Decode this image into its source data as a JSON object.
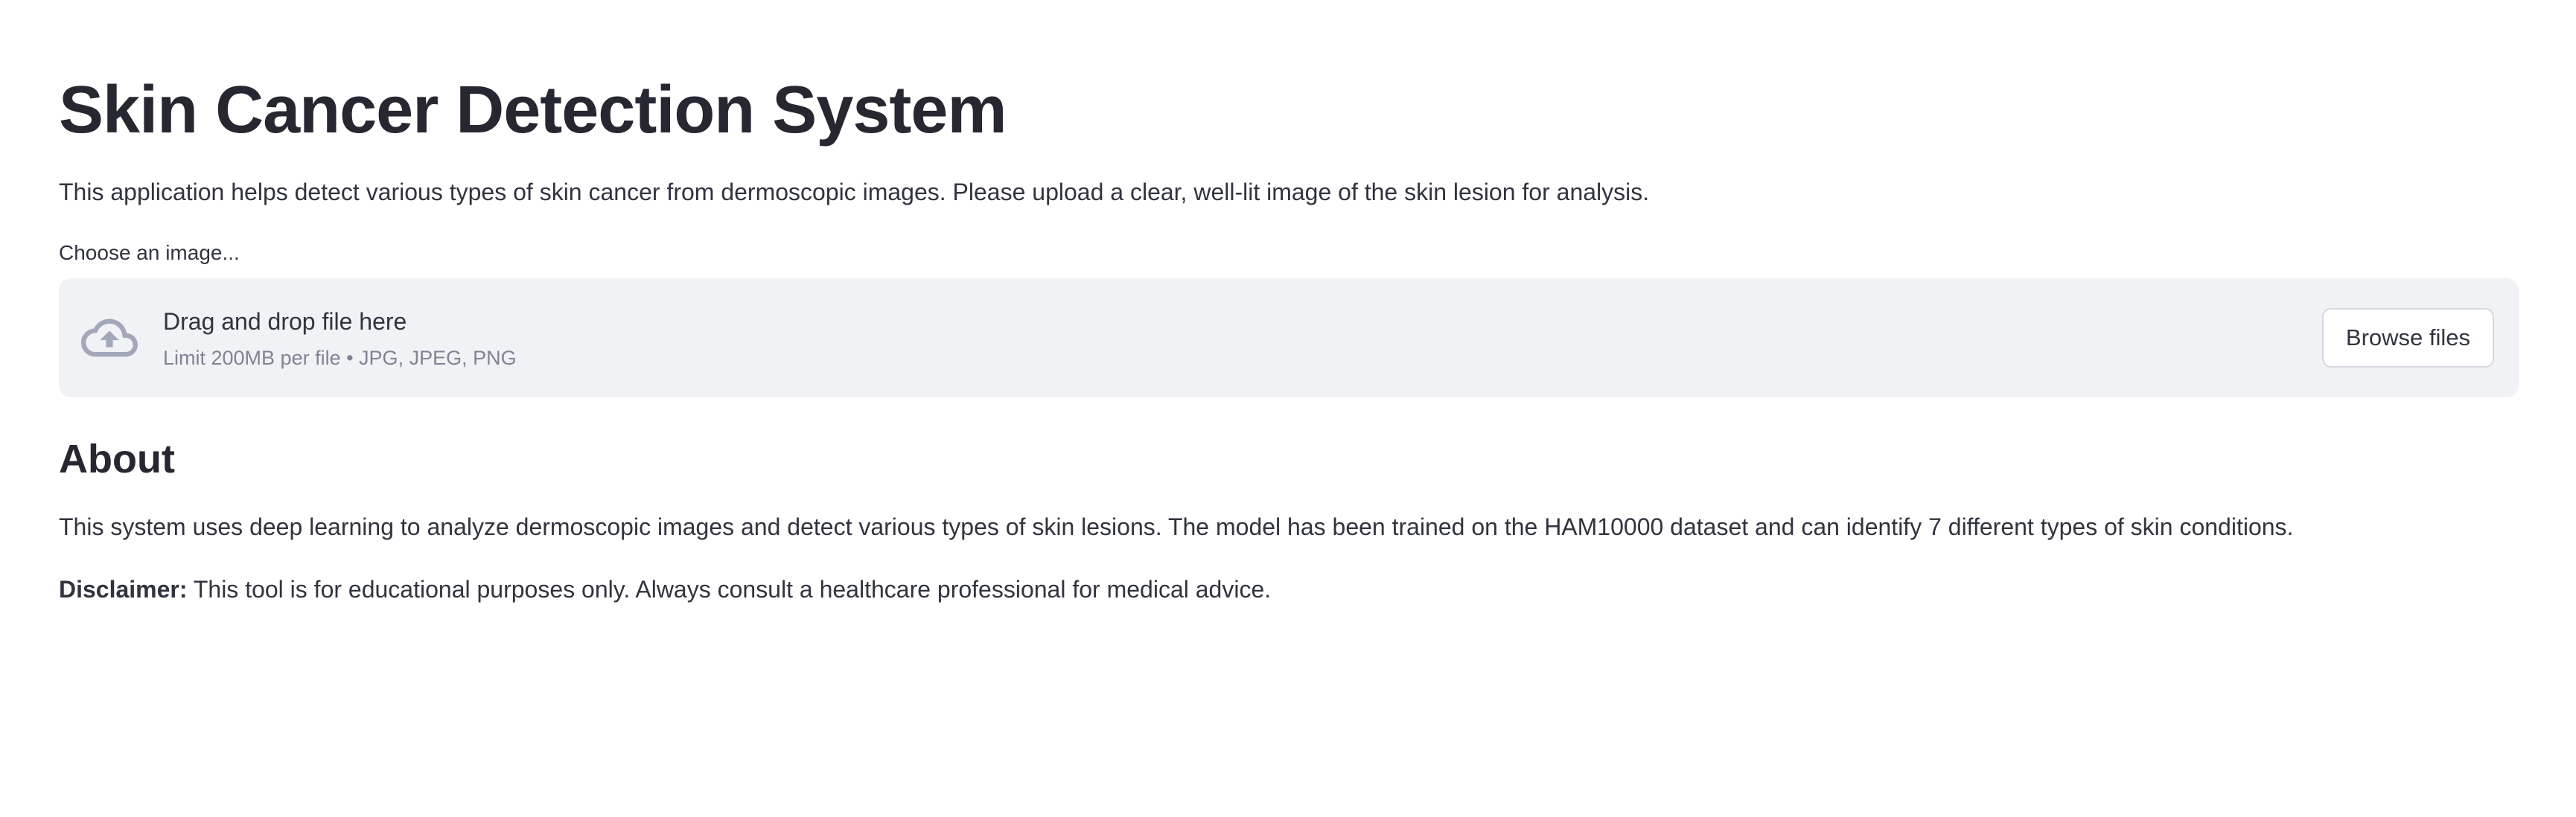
{
  "page": {
    "title": "Skin Cancer Detection System",
    "intro": "This application helps detect various types of skin cancer from dermoscopic images. Please upload a clear, well-lit image of the skin lesion for analysis."
  },
  "uploader": {
    "label": "Choose an image...",
    "drop_title": "Drag and drop file here",
    "limit_text": "Limit 200MB per file • JPG, JPEG, PNG",
    "browse_label": "Browse files",
    "icon": "cloud-upload-icon"
  },
  "about": {
    "heading": "About",
    "text": "This system uses deep learning to analyze dermoscopic images and detect various types of skin lesions. The model has been trained on the HAM10000 dataset and can identify 7 different types of skin conditions.",
    "disclaimer_label": "Disclaimer:",
    "disclaimer_text": " This tool is for educational purposes only. Always consult a healthcare professional for medical advice."
  },
  "colors": {
    "text": "#31333F",
    "heading": "#262730",
    "dropzone_bg": "#F0F2F6",
    "muted": "#808495",
    "icon": "#A3A8B8"
  }
}
